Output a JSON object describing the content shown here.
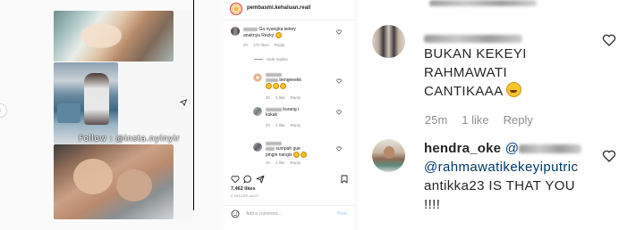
{
  "left": {
    "watermark": "Follow : @insta.nyinyir"
  },
  "post": {
    "account": "pembasmi.kehaluan.reall",
    "comments": [
      {
        "text_line1": "Ga nyangka kekey",
        "text_line2": "anaknya Rezky",
        "time": "2h",
        "likes": "170 likes",
        "reply": "Reply"
      },
      {
        "text": "bengeeekk",
        "time": "2h",
        "likes": "1 like",
        "reply": "Reply"
      },
      {
        "text_line1": "kurang i",
        "text_line2": "kakak",
        "time": "2h",
        "likes": "1 like",
        "reply": "Reply"
      },
      {
        "text_line1": "sumpah gue",
        "text_line2": "pingin nangis",
        "time": "2h",
        "likes": "1 like",
        "reply": "Reply"
      }
    ],
    "hide_replies": "Hide replies",
    "likes": "7,462 likes",
    "time": "2 HOURS AGO",
    "add_comment_placeholder": "Add a comment...",
    "post_button": "Post"
  },
  "zoom": {
    "comment1": {
      "line1": "BUKAN KEKEYI",
      "line2": "RAHMAWATI",
      "line3": "CANTIKAAA",
      "time": "25m",
      "likes": "1 like",
      "reply": "Reply"
    },
    "comment2": {
      "username": "hendra_oke",
      "mention_prefix": "@",
      "line2": "@rahmawatikekeyiputric",
      "line3": "antikka23 IS THAT YOU",
      "line4": "!!!!"
    }
  }
}
